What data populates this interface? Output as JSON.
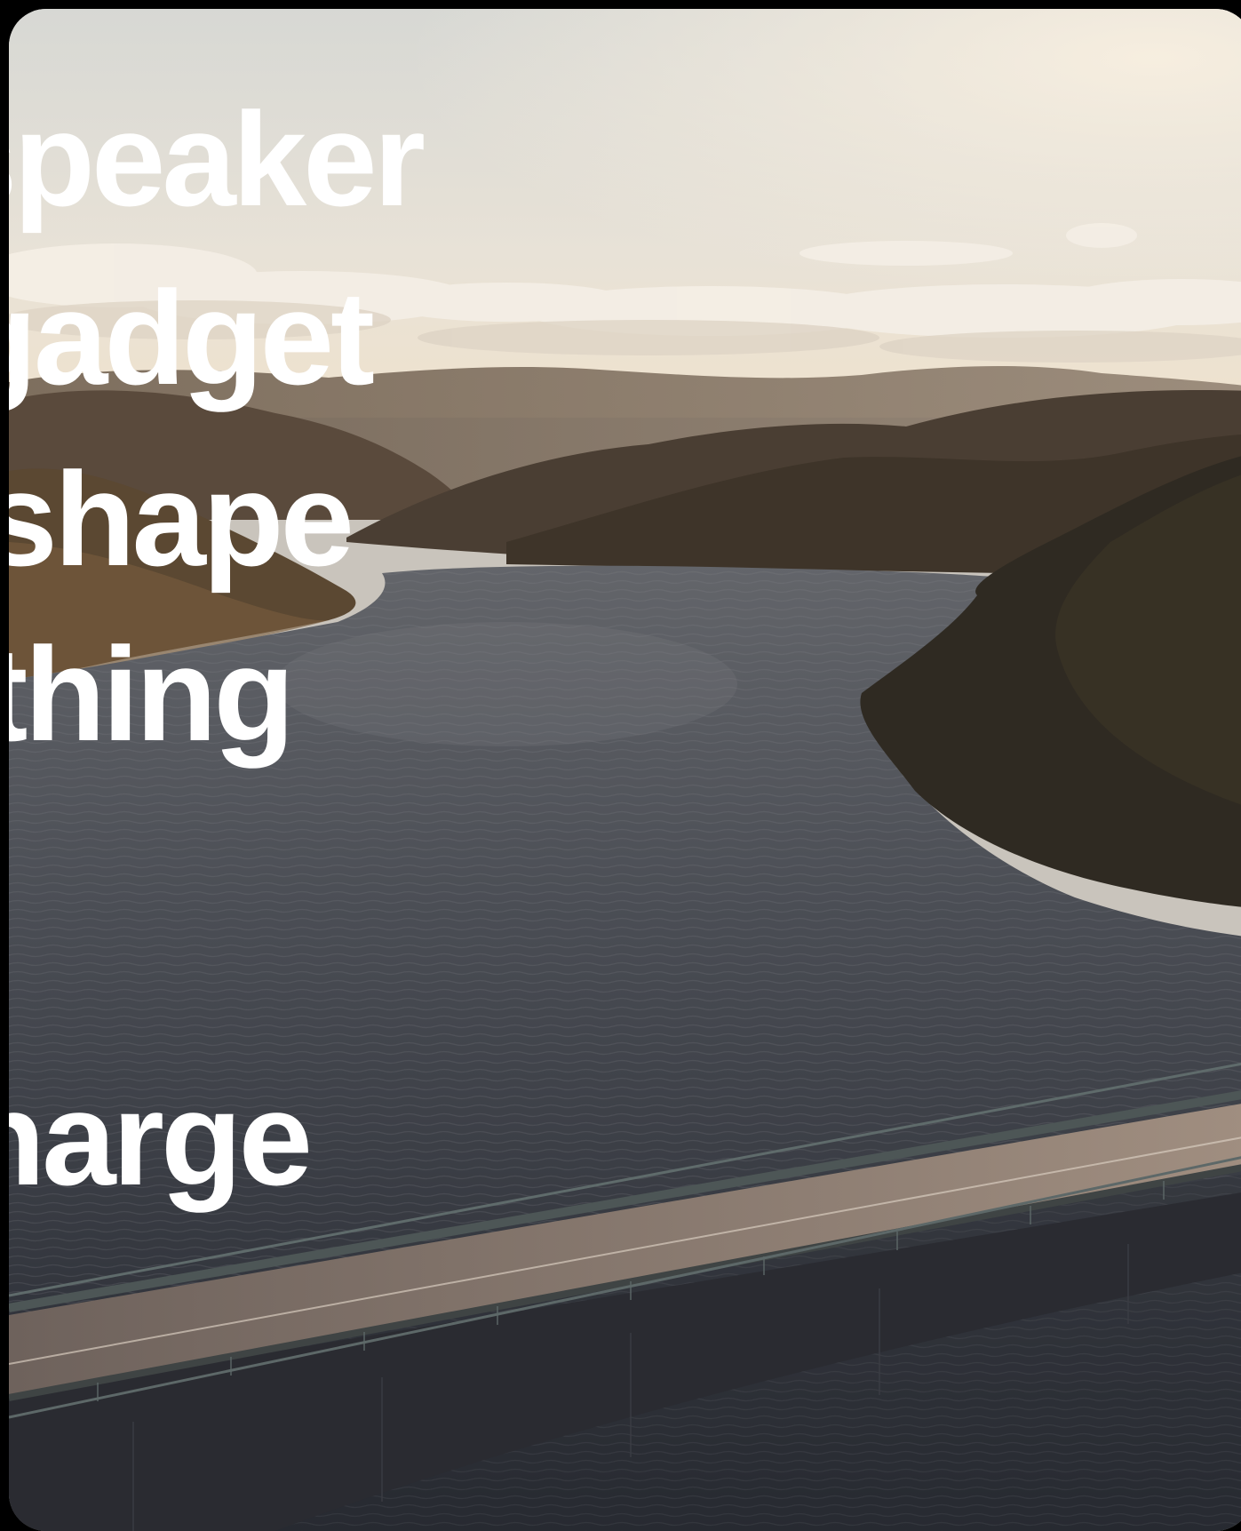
{
  "hero": {
    "headline_lines": [
      "speaker",
      "gadget",
      "shape",
      "thing",
      "",
      "charge"
    ]
  },
  "image": {
    "subject": "aerial-river-bridge-landscape",
    "colors": {
      "sky_top": "#dcdbd6",
      "sky_bottom": "#ece3d4",
      "sun_glow": "#f5ead8",
      "cloud": "#f3ede4",
      "far_hills": "#7a6a5c",
      "mid_hills": "#4e4236",
      "near_hills": "#3b3126",
      "forest_right": "#2c2820",
      "island_left": "#5a4730",
      "water_top": "#5b5d62",
      "water_bottom": "#2a2d35",
      "bridge_deck": "#7c6e66",
      "bridge_side": "#2a2b30",
      "rail": "#5d6868",
      "frame_bg": "#000000",
      "text": "#ffffff"
    }
  }
}
